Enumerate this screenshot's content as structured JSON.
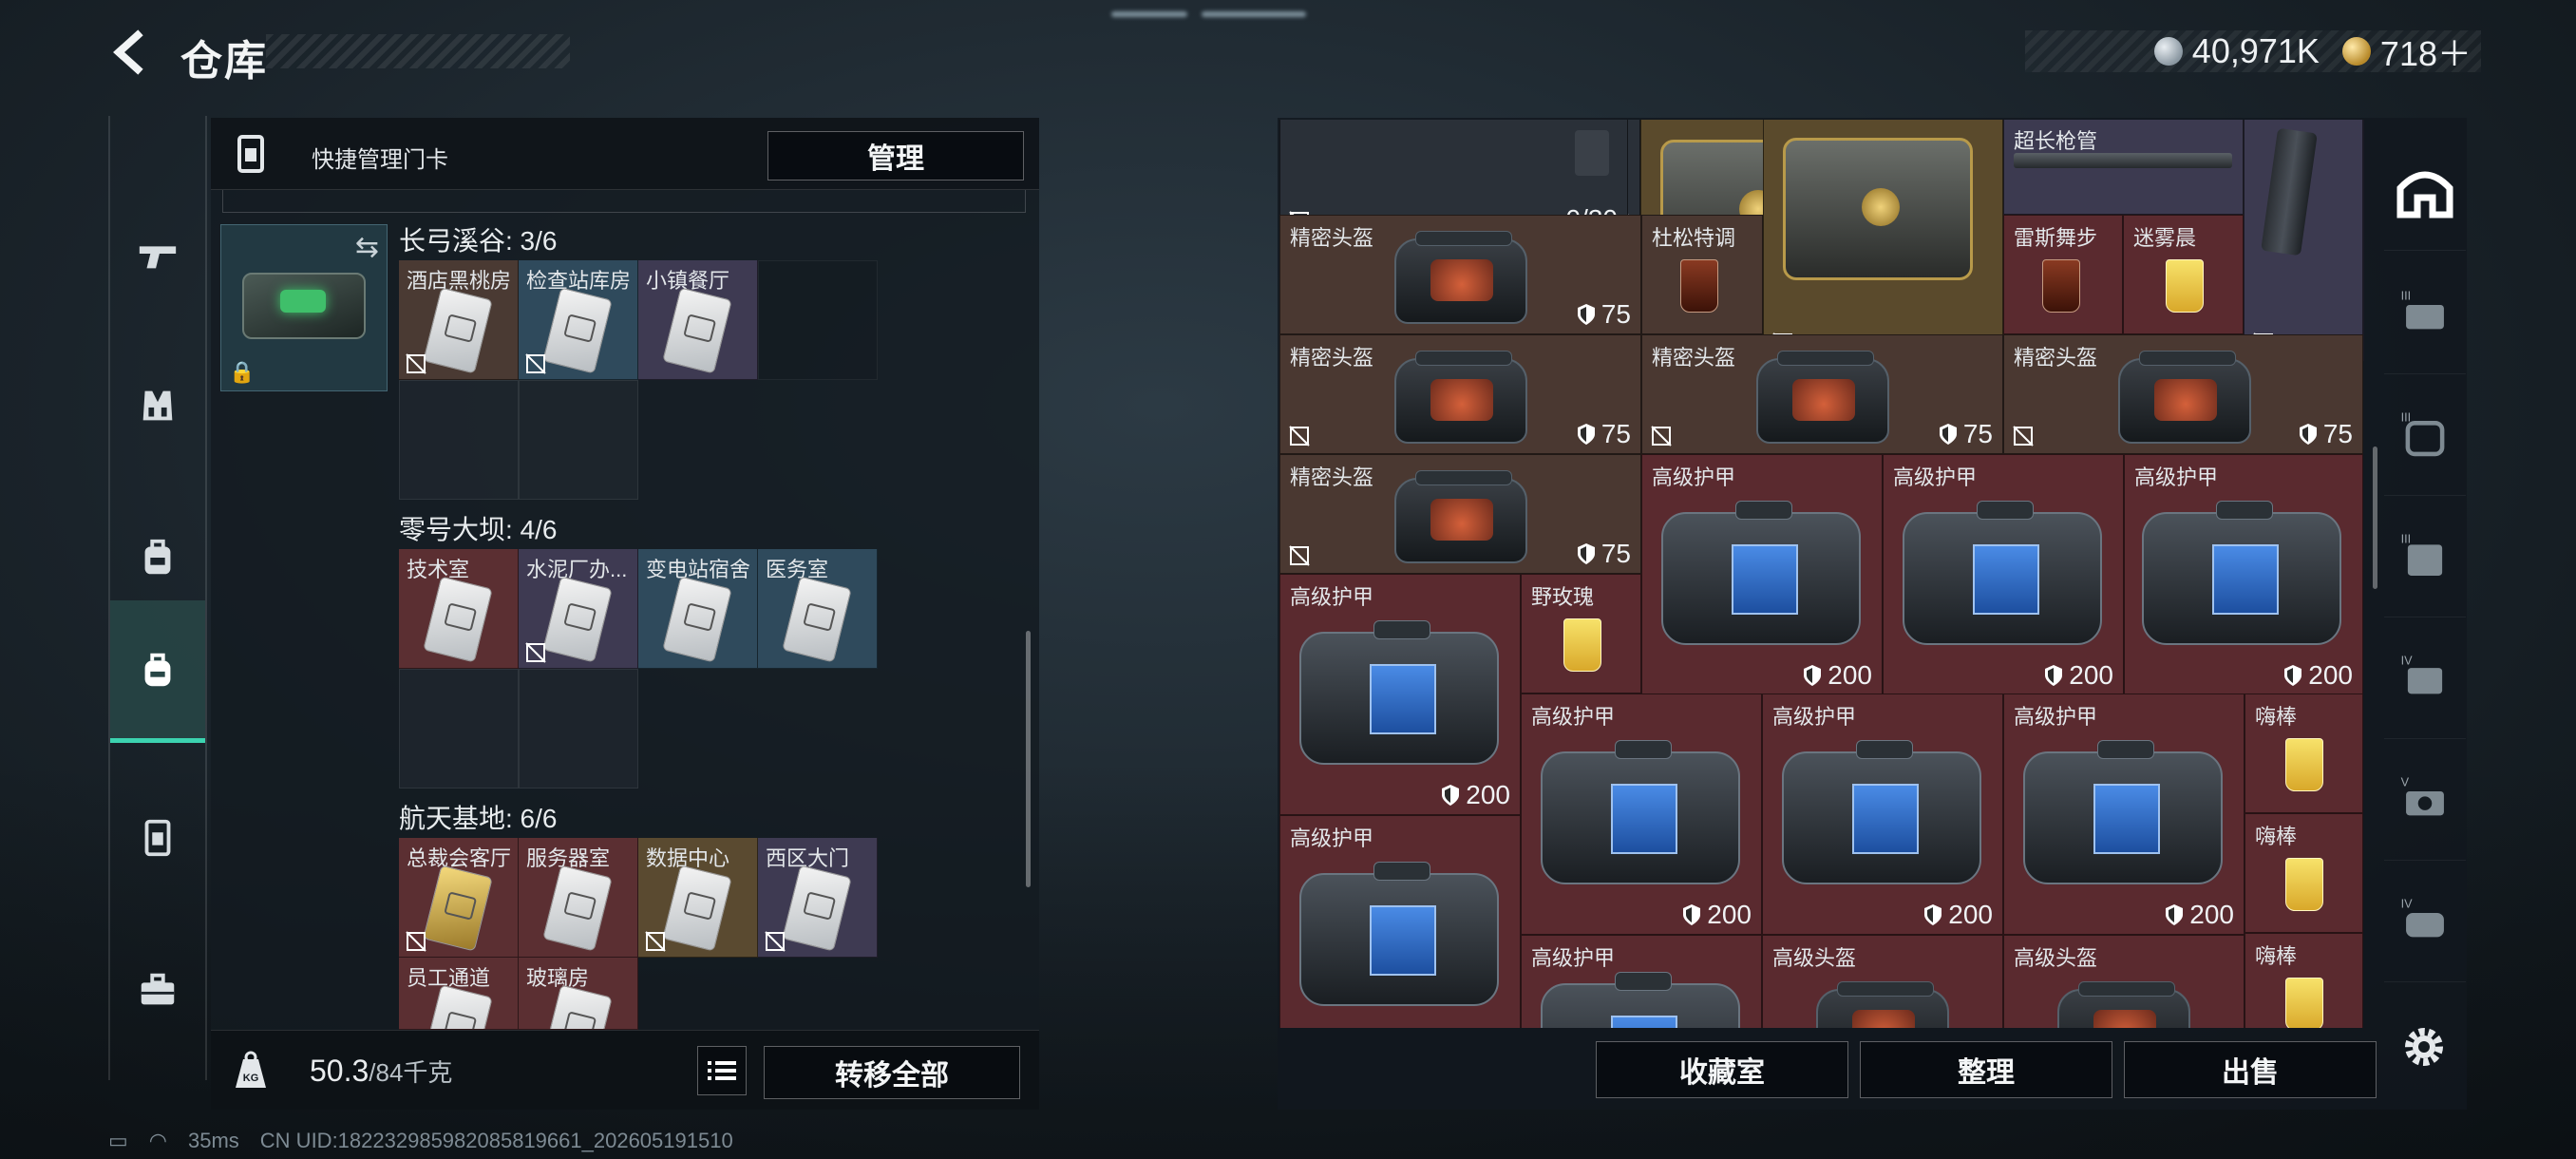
{
  "header": {
    "title": "仓库",
    "currency": [
      {
        "icon": "silver-coin-icon",
        "value": "40,971K"
      },
      {
        "icon": "gold-coin-icon",
        "value": "718＋"
      }
    ]
  },
  "sidebar": {
    "items": [
      {
        "icon": "gun-icon",
        "active": false
      },
      {
        "icon": "vest-icon",
        "active": false
      },
      {
        "icon": "backpack-icon",
        "active": false
      },
      {
        "icon": "backpack-icon",
        "active": true
      },
      {
        "icon": "keycard-icon",
        "active": false
      },
      {
        "icon": "toolbox-icon",
        "active": false
      }
    ]
  },
  "left_panel": {
    "header_label": "快捷管理门卡",
    "manage_button": "管理",
    "regions": [
      {
        "title": "长弓溪谷: 3/6",
        "cards": [
          {
            "name": "酒店黑桃房",
            "bg": "brown",
            "notrade": true
          },
          {
            "name": "检查站库房",
            "bg": "blue",
            "notrade": true
          },
          {
            "name": "小镇餐厅",
            "bg": "purple",
            "notrade": false
          }
        ]
      },
      {
        "title": "零号大坝: 4/6",
        "cards": [
          {
            "name": "技术室",
            "bg": "red",
            "notrade": false
          },
          {
            "name": "水泥厂办...",
            "bg": "purple",
            "notrade": true
          },
          {
            "name": "变电站宿舍",
            "bg": "blue",
            "notrade": false
          },
          {
            "name": "医务室",
            "bg": "blue",
            "notrade": false
          }
        ]
      },
      {
        "title": "航天基地: 6/6",
        "cards": [
          {
            "name": "总裁会客厅",
            "bg": "red",
            "notrade": true
          },
          {
            "name": "服务器室",
            "bg": "red",
            "notrade": false
          },
          {
            "name": "数据中心",
            "bg": "gold",
            "notrade": true
          },
          {
            "name": "西区大门",
            "bg": "purple",
            "notrade": true
          },
          {
            "name": "员工通道",
            "bg": "red",
            "notrade": false
          },
          {
            "name": "玻璃房",
            "bg": "red",
            "notrade": false
          }
        ]
      }
    ],
    "weight": "50.3",
    "weight_max": "/84千克",
    "transfer_button": "转移全部"
  },
  "status_bar": {
    "ping": "35ms",
    "uid": "CN UID:18223298598208581966​1_202605191510"
  },
  "stash": {
    "items": [
      {
        "name": "",
        "count": "0/30",
        "type": "ammo"
      },
      {
        "name": "",
        "type": "crate"
      },
      {
        "name": "超长枪管",
        "type": "barrel"
      },
      {
        "name": "",
        "type": "mag"
      },
      {
        "name": "精密头盔",
        "durability": "75",
        "type": "helmet"
      },
      {
        "name": "杜松特调",
        "type": "drink-dark"
      },
      {
        "name": "雷斯舞步",
        "type": "drink"
      },
      {
        "name": "迷雾晨",
        "type": "drink"
      },
      {
        "name": "精密头盔",
        "durability": "75",
        "type": "helmet"
      },
      {
        "name": "精密头盔",
        "durability": "75",
        "type": "helmet"
      },
      {
        "name": "精密头盔",
        "durability": "75",
        "type": "helmet"
      },
      {
        "name": "精密头盔",
        "durability": "75",
        "type": "helmet"
      },
      {
        "name": "高级护甲",
        "durability": "200",
        "type": "armor"
      },
      {
        "name": "高级护甲",
        "durability": "200",
        "type": "armor"
      },
      {
        "name": "高级护甲",
        "durability": "200",
        "type": "armor"
      },
      {
        "name": "高级护甲",
        "durability": "200",
        "type": "armor"
      },
      {
        "name": "野玫瑰",
        "type": "drink"
      },
      {
        "name": "高级护甲",
        "durability": "200",
        "type": "armor"
      },
      {
        "name": "高级护甲",
        "durability": "200",
        "type": "armor"
      },
      {
        "name": "高级护甲",
        "durability": "200",
        "type": "armor"
      },
      {
        "name": "嗨棒",
        "type": "drink"
      },
      {
        "name": "高级护甲",
        "type": "armor"
      },
      {
        "name": "嗨棒",
        "type": "drink"
      },
      {
        "name": "高级护甲",
        "type": "armor"
      },
      {
        "name": "高级头盔",
        "type": "helmet"
      },
      {
        "name": "高级头盔",
        "type": "helmet"
      },
      {
        "name": "嗨棒",
        "type": "drink"
      }
    ],
    "buttons": {
      "collection": "收藏室",
      "sort": "整理",
      "sell": "出售"
    }
  },
  "categories": [
    "all-icon",
    "tier-3-armor-icon",
    "tier-3-helmet-icon",
    "tier-3-vest-icon",
    "tier-4-armor-icon",
    "tier-5-armor-icon",
    "tier-4-helmet-icon"
  ]
}
